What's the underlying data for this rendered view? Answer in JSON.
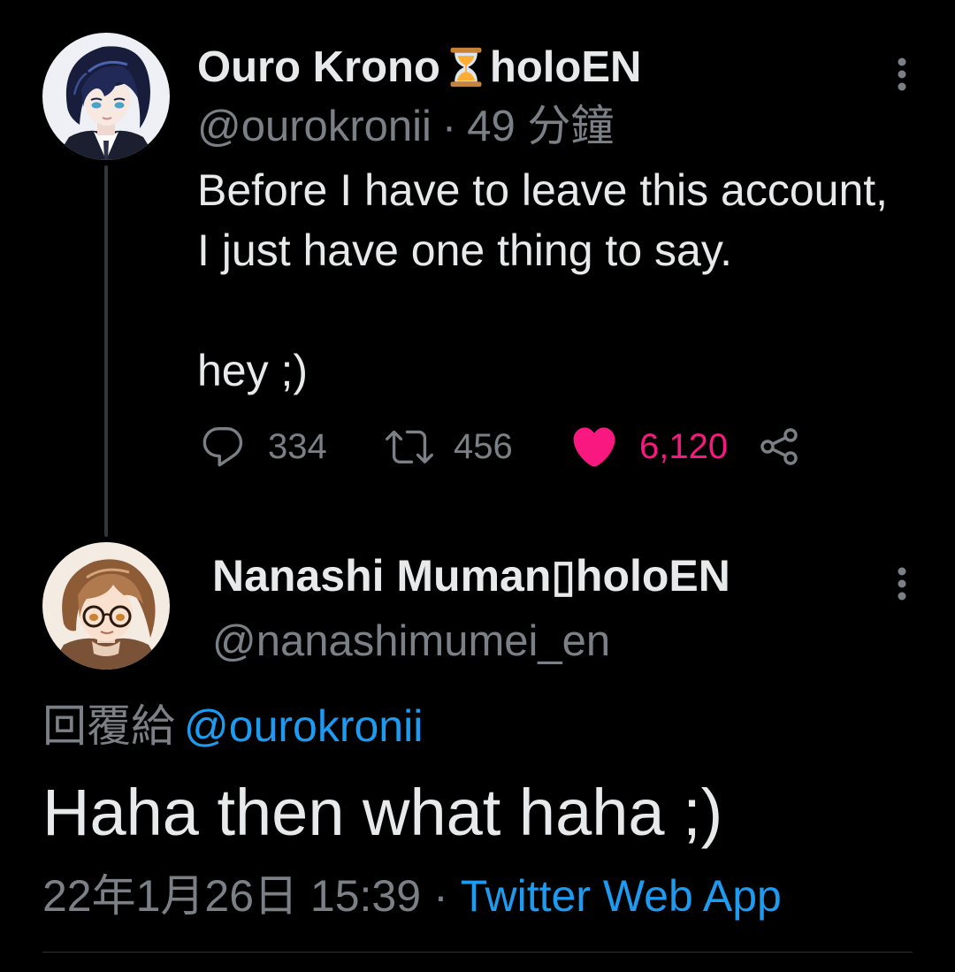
{
  "theme": {
    "background": "#000000",
    "text": "#e7e9ea",
    "muted": "#7b8086",
    "accent": "#1d9bf0",
    "like": "#f91880",
    "border": "#2f3336",
    "thread_line": "#333639"
  },
  "parent_tweet": {
    "author": {
      "name_prefix": "Ouro Krono",
      "name_icon": "hourglass-icon",
      "name_suffix": "holoEN",
      "handle": "@ourokronii",
      "separator": "·",
      "time": "49 分鐘"
    },
    "paragraphs": [
      [
        "Before I have to leave this account,",
        "I just have one thing to say."
      ],
      [
        "hey ;)"
      ]
    ],
    "actions": {
      "reply": {
        "icon": "reply-icon",
        "count": "334"
      },
      "retweet": {
        "icon": "retweet-icon",
        "count": "456"
      },
      "like": {
        "icon": "heart-icon",
        "count": "6,120",
        "liked": true
      },
      "share": {
        "icon": "share-icon"
      }
    },
    "menu_icon": "more-vertical-icon"
  },
  "focused_tweet": {
    "author": {
      "name": "Nanashi Muman▯holoEN",
      "handle": "@nanashimumei_en"
    },
    "reply_to": {
      "label": "回覆給",
      "handle": "@ourokronii"
    },
    "text": "Haha then what haha ;)",
    "date": "22年1月26日 15:39",
    "separator": "·",
    "source": "Twitter Web App",
    "menu_icon": "more-vertical-icon"
  }
}
